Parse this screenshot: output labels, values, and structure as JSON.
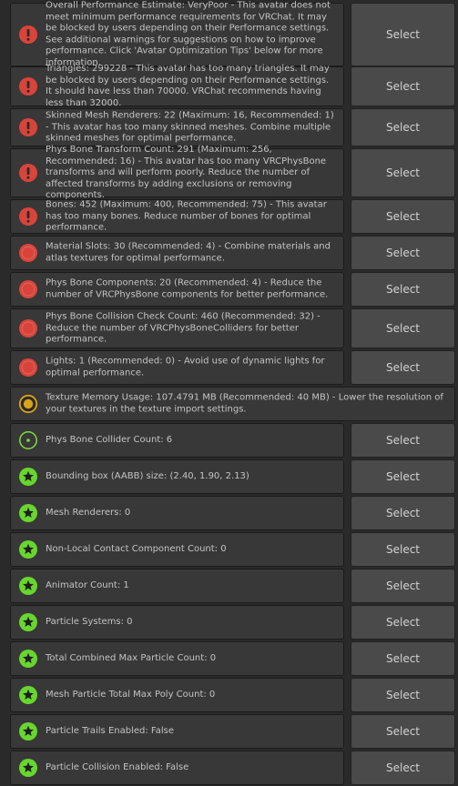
{
  "select_label": "Select",
  "colors": {
    "error": "#d9443a",
    "warning": "#d8a219",
    "info": "#7dde3a",
    "success": "#68d62e"
  },
  "items": [
    {
      "icon": "error-exclamation-icon",
      "text": "Overall Performance Estimate: VeryPoor - This avatar does not meet minimum performance requirements for VRChat. It may be blocked by users depending on their Performance settings. See additional warnings for suggestions on how to improve performance. Click 'Avatar Optimization Tips' below for more information.",
      "has_select": true
    },
    {
      "icon": "error-exclamation-icon",
      "text": "Triangles: 299228 - This avatar has too many triangles. It may be blocked by users depending on their Performance settings. It should have less than 70000. VRChat recommends having less than 32000.",
      "has_select": true
    },
    {
      "icon": "error-exclamation-icon",
      "text": "Skinned Mesh Renderers: 22 (Maximum: 16, Recommended: 1) - This avatar has too many skinned meshes. Combine multiple skinned meshes for optimal performance.",
      "has_select": true
    },
    {
      "icon": "error-exclamation-icon",
      "text": "Phys Bone Transform Count: 291 (Maximum: 256, Recommended: 16) - This avatar has too many VRCPhysBone transforms and will perform poorly. Reduce the number of affected transforms by adding exclusions or removing components.",
      "has_select": true
    },
    {
      "icon": "error-exclamation-icon",
      "text": "Bones: 452 (Maximum: 400, Recommended: 75) - This avatar has too many bones. Reduce number of bones for optimal performance.",
      "has_select": true
    },
    {
      "icon": "error-circle-icon",
      "text": "Material Slots: 30 (Recommended: 4) - Combine materials and atlas textures for optimal performance.",
      "has_select": true
    },
    {
      "icon": "error-circle-icon",
      "text": "Phys Bone Components: 20 (Recommended: 4) - Reduce the number of VRCPhysBone components for better performance.",
      "has_select": true
    },
    {
      "icon": "error-circle-icon",
      "text": "Phys Bone Collision Check Count: 460 (Recommended: 32) - Reduce the number of VRCPhysBoneColliders for better performance.",
      "has_select": true
    },
    {
      "icon": "error-circle-icon",
      "text": "Lights: 1 (Recommended: 0) - Avoid use of dynamic lights for optimal performance.",
      "has_select": true
    },
    {
      "icon": "warning-ring-icon",
      "text": "Texture Memory Usage: 107.4791 MB (Recommended: 40 MB) - Lower the resolution of your textures in the texture import settings.",
      "has_select": false
    },
    {
      "icon": "info-ring-dot-icon",
      "text": "Phys Bone Collider Count: 6",
      "has_select": true
    },
    {
      "icon": "star-icon",
      "text": "Bounding box (AABB) size: (2.40, 1.90, 2.13)",
      "has_select": true
    },
    {
      "icon": "star-icon",
      "text": "Mesh Renderers: 0",
      "has_select": true
    },
    {
      "icon": "star-icon",
      "text": "Non-Local Contact Component Count: 0",
      "has_select": true
    },
    {
      "icon": "star-icon",
      "text": "Animator Count: 1",
      "has_select": true
    },
    {
      "icon": "star-icon",
      "text": "Particle Systems: 0",
      "has_select": true
    },
    {
      "icon": "star-icon",
      "text": "Total Combined Max Particle Count: 0",
      "has_select": true
    },
    {
      "icon": "star-icon",
      "text": "Mesh Particle Total Max Poly Count: 0",
      "has_select": true
    },
    {
      "icon": "star-icon",
      "text": "Particle Trails Enabled: False",
      "has_select": true
    },
    {
      "icon": "star-icon",
      "text": "Particle Collision Enabled: False",
      "has_select": true
    }
  ]
}
